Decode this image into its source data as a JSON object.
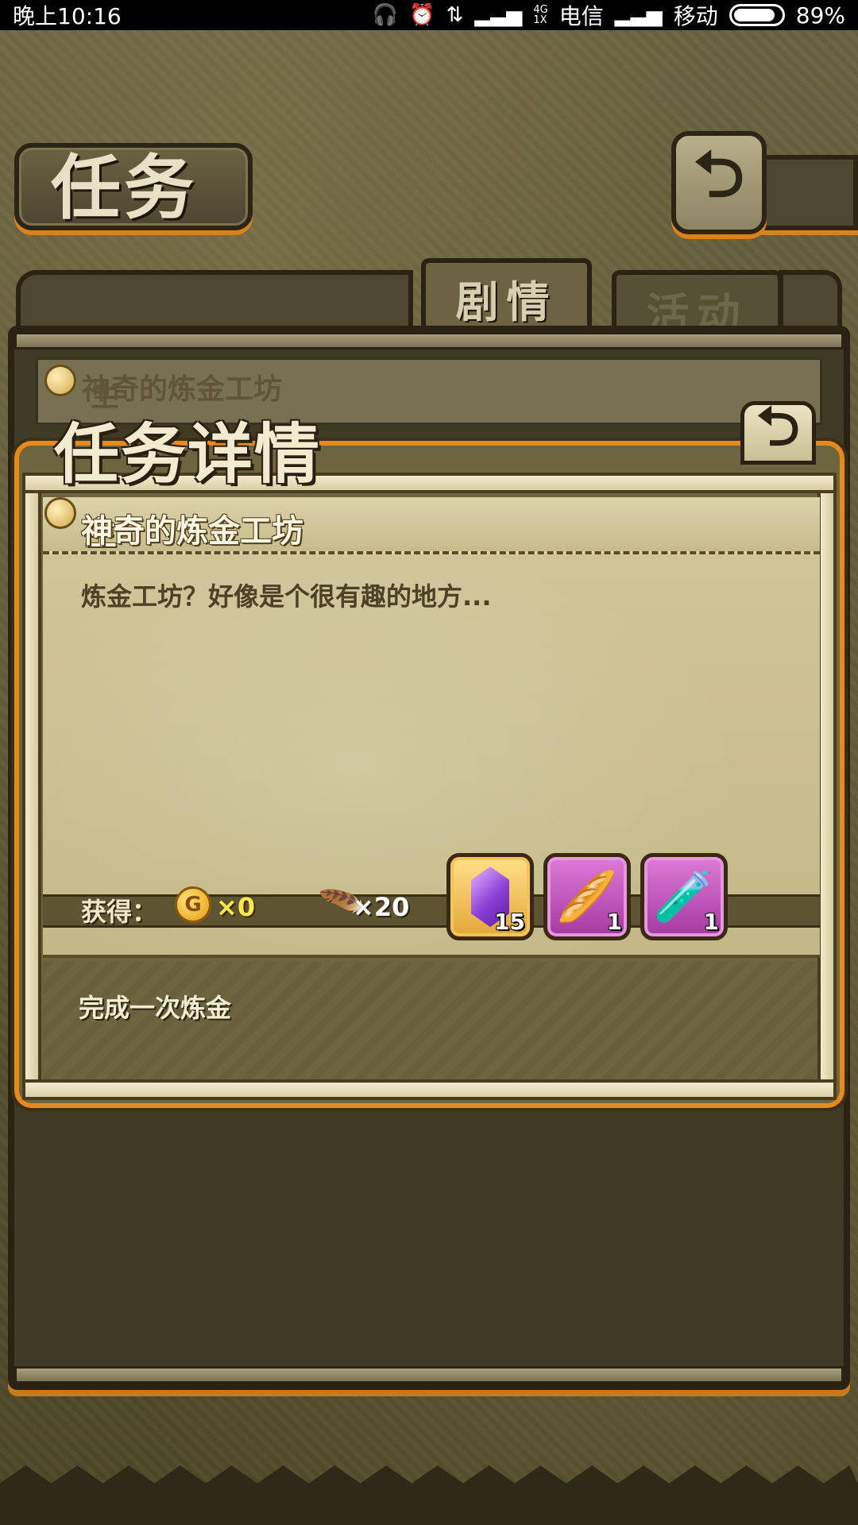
{
  "status_bar": {
    "time": "晚上10:16",
    "network_type": "4G",
    "network_sub": "1X",
    "carrier1": "电信",
    "carrier2": "移动",
    "battery": "89%",
    "battery_level": 0.89
  },
  "header": {
    "title": "任务",
    "back_icon": "return-arrow-icon"
  },
  "tabs": [
    {
      "label": "剧情",
      "active": true
    },
    {
      "label": "活动",
      "active": false
    }
  ],
  "quest_list": [
    {
      "badge": "主",
      "title": "神奇的炼金工坊"
    }
  ],
  "detail": {
    "title": "任务详情",
    "badge": "主",
    "quest_name": "神奇的炼金工坊",
    "description": "炼金工坊？好像是个很有趣的地方...",
    "reward_label": "获得：",
    "gold_icon_letter": "G",
    "gold_amount": "×0",
    "feather_amount": "×20",
    "items": [
      {
        "icon": "purple-crystal-icon",
        "count": "15",
        "frame": "gold"
      },
      {
        "icon": "bread-basket-icon",
        "count": "1",
        "frame": "purple"
      },
      {
        "icon": "purple-potion-icon",
        "count": "1",
        "frame": "purple"
      }
    ],
    "condition": "完成一次炼金"
  },
  "colors": {
    "accent_orange": "#e68a1e",
    "parchment": "#d2c79c",
    "gold_text": "#ffe94a"
  }
}
